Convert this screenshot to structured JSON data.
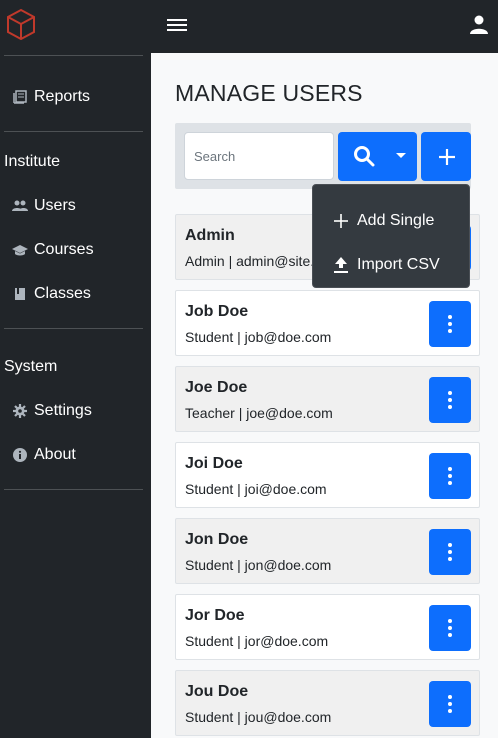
{
  "sidebar": {
    "logo_icon": "cube-logo-icon",
    "top_items": [
      {
        "label": "Reports",
        "icon": "book-icon"
      }
    ],
    "institute": {
      "header": "Institute",
      "items": [
        {
          "label": "Users",
          "icon": "people-icon"
        },
        {
          "label": "Courses",
          "icon": "graduation-cap-icon"
        },
        {
          "label": "Classes",
          "icon": "book-closed-icon"
        }
      ]
    },
    "system": {
      "header": "System",
      "items": [
        {
          "label": "Settings",
          "icon": "gear-icon"
        },
        {
          "label": "About",
          "icon": "info-icon"
        }
      ]
    }
  },
  "topbar": {
    "menu_icon": "hamburger-icon",
    "account_icon": "user-icon"
  },
  "main": {
    "title": "MANAGE USERS",
    "search": {
      "placeholder": "Search",
      "value": ""
    },
    "dropdown": {
      "items": [
        {
          "label": "Add Single",
          "icon": "plus-icon"
        },
        {
          "label": "Import CSV",
          "icon": "upload-icon"
        }
      ]
    },
    "users": [
      {
        "name": "Admin",
        "meta": "Admin | admin@site.",
        "shaded": true
      },
      {
        "name": "Job Doe",
        "meta": "Student | job@doe.com",
        "shaded": false
      },
      {
        "name": "Joe Doe",
        "meta": "Teacher | joe@doe.com",
        "shaded": true
      },
      {
        "name": "Joi Doe",
        "meta": "Student | joi@doe.com",
        "shaded": false
      },
      {
        "name": "Jon Doe",
        "meta": "Student | jon@doe.com",
        "shaded": true
      },
      {
        "name": "Jor Doe",
        "meta": "Student | jor@doe.com",
        "shaded": false
      },
      {
        "name": "Jou Doe",
        "meta": "Student | jou@doe.com",
        "shaded": true
      }
    ]
  },
  "colors": {
    "primary": "#0d6efd",
    "sidebar": "#212529",
    "dropdown": "#343a40"
  }
}
